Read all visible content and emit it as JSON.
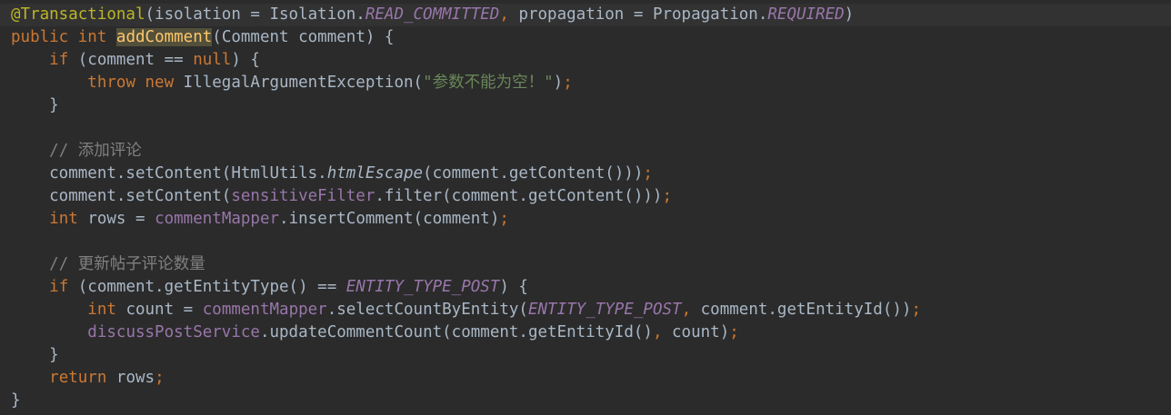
{
  "editor": {
    "lines": [
      [
        {
          "t": "@Transactional",
          "c": "ann"
        },
        {
          "t": "(isolation = Isolation.",
          "c": ""
        },
        {
          "t": "READ_COMMITTED",
          "c": "const"
        },
        {
          "t": ", ",
          "c": "kw"
        },
        {
          "t": "propagation = Propagation.",
          "c": ""
        },
        {
          "t": "REQUIRED",
          "c": "const"
        },
        {
          "t": ")",
          "c": ""
        }
      ],
      [
        {
          "t": "public ",
          "c": "kw"
        },
        {
          "t": "int ",
          "c": "kw"
        },
        {
          "t": "addComment",
          "c": "fn hl"
        },
        {
          "t": "(Comment comment) {",
          "c": ""
        }
      ],
      [
        {
          "t": "    ",
          "c": ""
        },
        {
          "t": "if ",
          "c": "kw"
        },
        {
          "t": "(comment == ",
          "c": ""
        },
        {
          "t": "null",
          "c": "kw"
        },
        {
          "t": ") {",
          "c": ""
        }
      ],
      [
        {
          "t": "        ",
          "c": ""
        },
        {
          "t": "throw new ",
          "c": "kw"
        },
        {
          "t": "IllegalArgumentException(",
          "c": ""
        },
        {
          "t": "\"参数不能为空！\"",
          "c": "str"
        },
        {
          "t": ")",
          "c": ""
        },
        {
          "t": ";",
          "c": "kw"
        }
      ],
      [
        {
          "t": "    }",
          "c": ""
        }
      ],
      [],
      [
        {
          "t": "    ",
          "c": ""
        },
        {
          "t": "// 添加评论",
          "c": "cmt"
        }
      ],
      [
        {
          "t": "    comment.setContent(HtmlUtils.",
          "c": ""
        },
        {
          "t": "htmlEscape",
          "c": "static"
        },
        {
          "t": "(comment.getContent()))",
          "c": ""
        },
        {
          "t": ";",
          "c": "kw"
        }
      ],
      [
        {
          "t": "    comment.setContent(",
          "c": ""
        },
        {
          "t": "sensitiveFilter",
          "c": "field"
        },
        {
          "t": ".filter(comment.getContent()))",
          "c": ""
        },
        {
          "t": ";",
          "c": "kw"
        }
      ],
      [
        {
          "t": "    ",
          "c": ""
        },
        {
          "t": "int ",
          "c": "kw"
        },
        {
          "t": "rows = ",
          "c": ""
        },
        {
          "t": "commentMapper",
          "c": "field"
        },
        {
          "t": ".insertComment(comment)",
          "c": ""
        },
        {
          "t": ";",
          "c": "kw"
        }
      ],
      [],
      [
        {
          "t": "    ",
          "c": ""
        },
        {
          "t": "// 更新帖子评论数量",
          "c": "cmt"
        }
      ],
      [
        {
          "t": "    ",
          "c": ""
        },
        {
          "t": "if ",
          "c": "kw"
        },
        {
          "t": "(comment.getEntityType() == ",
          "c": ""
        },
        {
          "t": "ENTITY_TYPE_POST",
          "c": "const"
        },
        {
          "t": ") {",
          "c": ""
        }
      ],
      [
        {
          "t": "        ",
          "c": ""
        },
        {
          "t": "int ",
          "c": "kw"
        },
        {
          "t": "count = ",
          "c": ""
        },
        {
          "t": "commentMapper",
          "c": "field"
        },
        {
          "t": ".selectCountByEntity(",
          "c": ""
        },
        {
          "t": "ENTITY_TYPE_POST",
          "c": "const"
        },
        {
          "t": ", ",
          "c": "kw"
        },
        {
          "t": "comment.getEntityId())",
          "c": ""
        },
        {
          "t": ";",
          "c": "kw"
        }
      ],
      [
        {
          "t": "        ",
          "c": ""
        },
        {
          "t": "discussPostService",
          "c": "field"
        },
        {
          "t": ".updateCommentCount(comment.getEntityId()",
          "c": ""
        },
        {
          "t": ", ",
          "c": "kw"
        },
        {
          "t": "count)",
          "c": ""
        },
        {
          "t": ";",
          "c": "kw"
        }
      ],
      [
        {
          "t": "    }",
          "c": ""
        }
      ],
      [
        {
          "t": "    ",
          "c": ""
        },
        {
          "t": "return ",
          "c": "kw"
        },
        {
          "t": "rows",
          "c": ""
        },
        {
          "t": ";",
          "c": "kw"
        }
      ],
      [
        {
          "t": "}",
          "c": ""
        }
      ]
    ]
  },
  "colors": {
    "background": "#2b2b2b",
    "current_line": "#323232",
    "text": "#a9b7c6",
    "keyword": "#cc7832",
    "annotation": "#bbb529",
    "constant": "#9876aa",
    "string": "#6a8759",
    "comment": "#808080",
    "method_declaration": "#ffc66d",
    "identifier_highlight": "#52503a"
  }
}
